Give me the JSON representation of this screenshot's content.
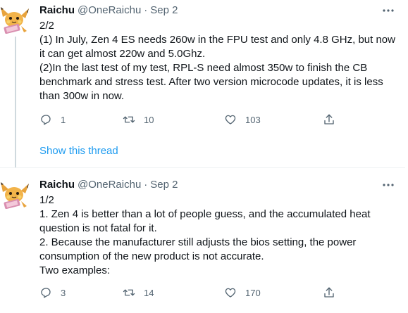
{
  "tweets": [
    {
      "name": "Raichu",
      "handle": "@OneRaichu",
      "separator": "·",
      "date": "Sep 2",
      "lines": [
        "2/2",
        "(1) In July, Zen 4 ES needs 260w in the FPU test and only 4.8 GHz, but now",
        "it can get almost 220w and 5.0Ghz.",
        "(2)In the last test of my test, RPL-S need almost 350w to finish the CB",
        "benchmark and stress test. After two version microcode updates, it is less",
        "than 300w in now."
      ],
      "replies": "1",
      "retweets": "10",
      "likes": "103",
      "show_thread": "Show this thread"
    },
    {
      "name": "Raichu",
      "handle": "@OneRaichu",
      "separator": "·",
      "date": "Sep 2",
      "lines": [
        "1/2",
        "1. Zen 4 is better than a lot of people guess, and the accumulated heat",
        "question is not fatal for it.",
        "2. Because the manufacturer still adjusts the bios setting, the power",
        "consumption of the new product is not accurate.",
        "Two examples:"
      ],
      "replies": "3",
      "retweets": "14",
      "likes": "170"
    }
  ],
  "icons": {
    "avatar": "raichu-avatar",
    "more": "more-horizontal-icon",
    "reply": "reply-icon",
    "retweet": "retweet-icon",
    "like": "heart-icon",
    "share": "share-icon"
  },
  "colors": {
    "text": "#0f1419",
    "secondary": "#536471",
    "link": "#1d9bf0",
    "divider": "#eff3f4",
    "thread_line": "#cfd9de"
  }
}
